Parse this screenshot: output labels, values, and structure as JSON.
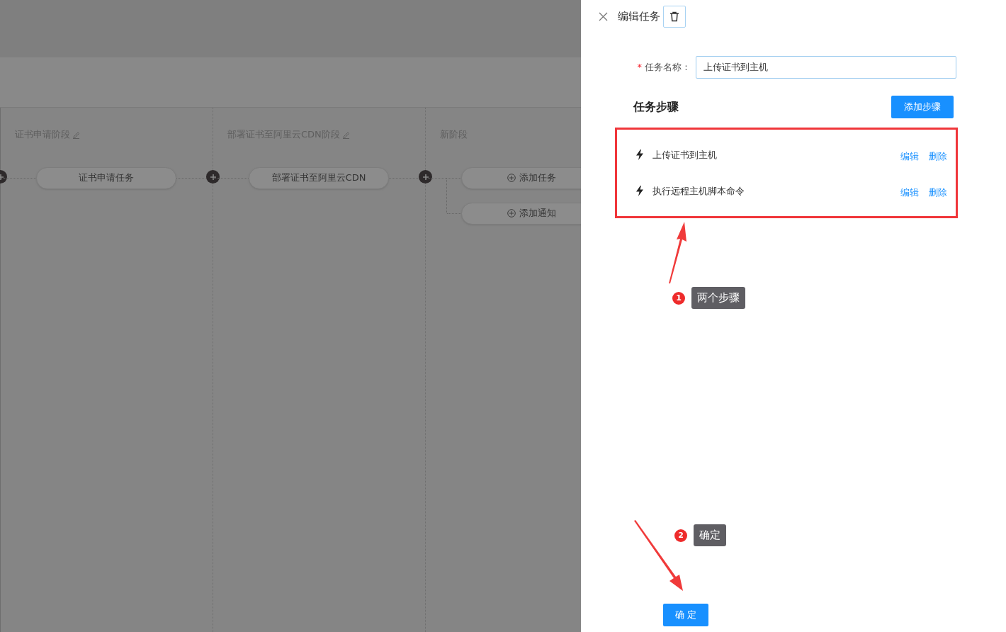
{
  "pipeline": {
    "stages": [
      {
        "title": "证书申请阶段",
        "editable": true,
        "tasks": [
          {
            "kind": "task",
            "label": "证书申请任务"
          }
        ]
      },
      {
        "title": "部署证书至阿里云CDN阶段",
        "editable": true,
        "tasks": [
          {
            "kind": "task",
            "label": "部署证书至阿里云CDN"
          }
        ]
      },
      {
        "title": "新阶段",
        "editable": false,
        "tasks": [
          {
            "kind": "add",
            "label": "添加任务"
          },
          {
            "kind": "add",
            "label": "添加通知"
          }
        ]
      }
    ]
  },
  "drawer": {
    "title": "编辑任务",
    "field": {
      "label": "任务名称：",
      "required_mark": "*",
      "value": "上传证书到主机"
    },
    "section_title": "任务步骤",
    "add_button": "添加步骤",
    "steps": [
      {
        "name": "上传证书到主机",
        "actions": [
          "编辑",
          "删除"
        ]
      },
      {
        "name": "执行远程主机脚本命令",
        "actions": [
          "编辑",
          "删除"
        ]
      }
    ],
    "confirm_button": "确 定"
  },
  "annotations": [
    {
      "number": "1",
      "label": "两个步骤"
    },
    {
      "number": "2",
      "label": "确定"
    }
  ]
}
